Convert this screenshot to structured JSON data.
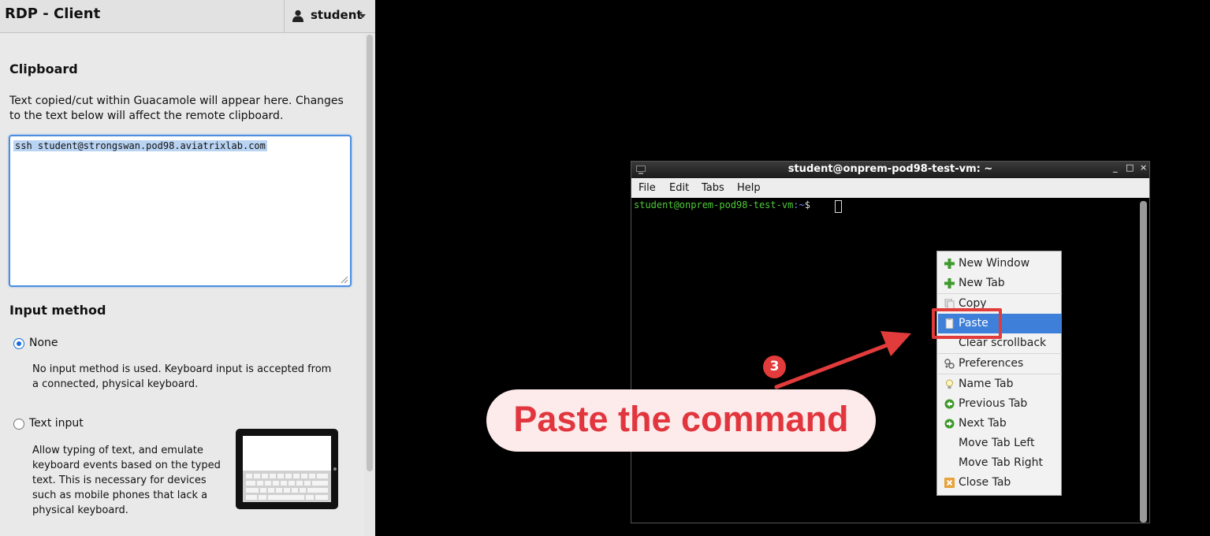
{
  "header": {
    "title": "RDP - Client",
    "user": "student"
  },
  "clipboard": {
    "heading": "Clipboard",
    "description": "Text copied/cut within Guacamole will appear here. Changes to the text below will affect the remote clipboard.",
    "content": "ssh student@strongswan.pod98.aviatrixlab.com"
  },
  "input_method": {
    "heading": "Input method",
    "options": [
      {
        "label": "None",
        "selected": true,
        "description": "No input method is used. Keyboard input is accepted from a connected, physical keyboard."
      },
      {
        "label": "Text input",
        "selected": false,
        "description": "Allow typing of text, and emulate keyboard events based on the typed text. This is necessary for devices such as mobile phones that lack a physical keyboard."
      }
    ]
  },
  "terminal": {
    "title": "student@onprem-pod98-test-vm: ~",
    "window_buttons": [
      "_",
      "□",
      "×"
    ],
    "menu": [
      "File",
      "Edit",
      "Tabs",
      "Help"
    ],
    "prompt_user": "student@onprem-pod98-test-vm",
    "prompt_path": ":~",
    "prompt_symbol": "$"
  },
  "context_menu": {
    "items": [
      {
        "label": "New Window",
        "icon": "plus-icon"
      },
      {
        "label": "New Tab",
        "icon": "plus-icon"
      },
      {
        "label": "Copy",
        "icon": "copy-icon"
      },
      {
        "label": "Paste",
        "icon": "paste-icon",
        "selected": true
      },
      {
        "label": "Clear scrollback",
        "icon": ""
      },
      {
        "label": "Preferences",
        "icon": "preferences-icon"
      },
      {
        "label": "Name Tab",
        "icon": "lightbulb-icon"
      },
      {
        "label": "Previous Tab",
        "icon": "previous-icon"
      },
      {
        "label": "Next Tab",
        "icon": "next-icon"
      },
      {
        "label": "Move Tab Left",
        "icon": ""
      },
      {
        "label": "Move Tab Right",
        "icon": ""
      },
      {
        "label": "Close Tab",
        "icon": "close-tab-icon"
      }
    ]
  },
  "annotation": {
    "step": "3",
    "callout": "Paste the command"
  },
  "colors": {
    "accent": "#e23b3b",
    "selection": "#3d7fd9",
    "prompt_green": "#4ec938"
  }
}
